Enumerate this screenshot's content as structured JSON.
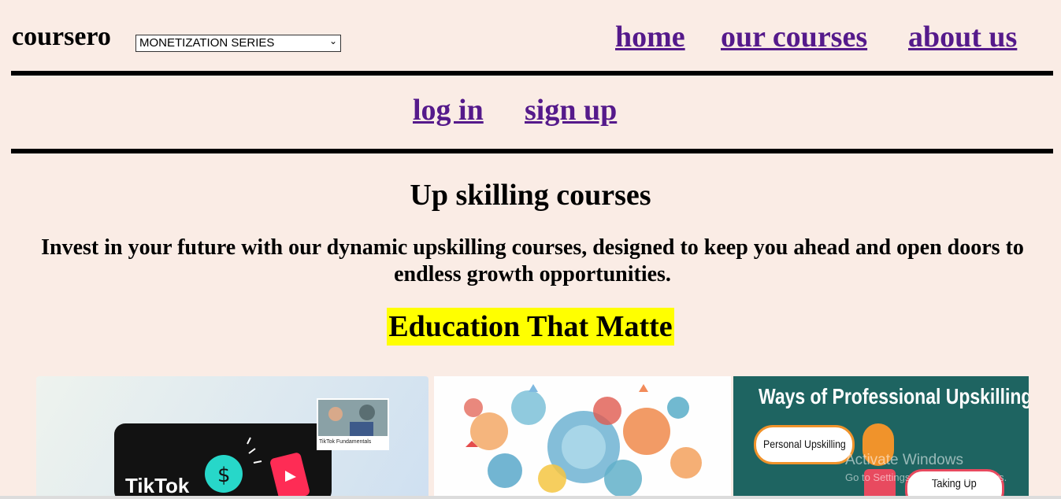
{
  "header": {
    "brand": "coursero",
    "series_select": "MONETIZATION SERIES",
    "nav": [
      "home",
      "our courses",
      "about us"
    ]
  },
  "auth": {
    "login": "log in",
    "signup": "sign up"
  },
  "main": {
    "title": "Up skilling courses",
    "lead": "Invest in your future with our dynamic upskilling courses, designed to keep you ahead and open doors to endless growth opportunities.",
    "tagline": "Education That Matte"
  },
  "cards": {
    "tiktok": {
      "brand": "TikTok",
      "thumb_label": "TikTok Fundamentals"
    },
    "upskilling": {
      "title": "Ways of Professional Upskilling",
      "item1": "Personal Upskilling",
      "item2": "Taking Up"
    }
  },
  "os_overlay": {
    "title": "Activate Windows",
    "subtitle": "Go to Settings to activate Windows."
  },
  "colors": {
    "background": "#faece5",
    "link": "#551a8b",
    "highlight": "#ffff00",
    "card3_bg": "#1e6461"
  }
}
